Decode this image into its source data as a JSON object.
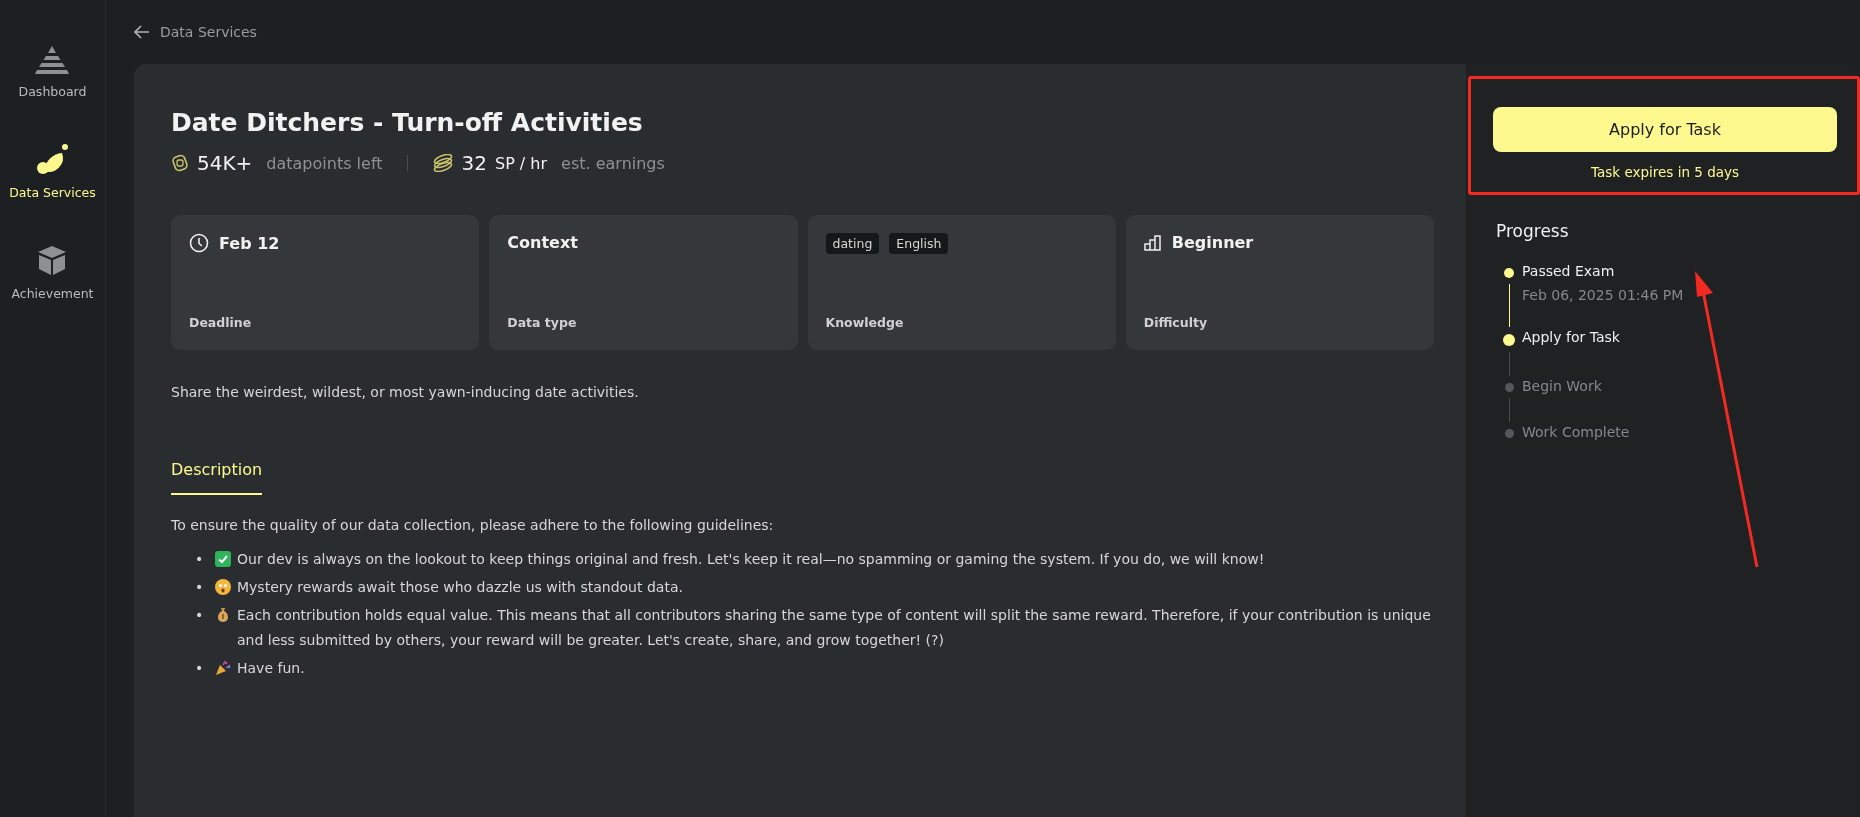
{
  "sidebar": {
    "items": [
      {
        "label": "Dashboard",
        "selected": false
      },
      {
        "label": "Data Services",
        "selected": true
      },
      {
        "label": "Achievement",
        "selected": false
      }
    ]
  },
  "breadcrumb": {
    "label": "Data Services"
  },
  "task": {
    "title": "Date Ditchers - Turn-off Activities",
    "stats": {
      "datapoints": "54K+",
      "datapoints_label": "datapoints left",
      "earnings": "32",
      "earnings_unit": "SP / hr",
      "earnings_label": "est. earnings"
    },
    "info_cards": [
      {
        "kind": "deadline",
        "value": "Feb 12",
        "label": "Deadline"
      },
      {
        "kind": "text",
        "value": "Context",
        "label": "Data type"
      },
      {
        "kind": "tags",
        "tags": [
          "dating",
          "English"
        ],
        "label": "Knowledge"
      },
      {
        "kind": "difficulty",
        "value": "Beginner",
        "label": "Difficulty"
      }
    ],
    "summary": "Share the weirdest, wildest, or most yawn-inducing date activities.",
    "tabs": [
      {
        "label": "Description",
        "selected": true
      }
    ],
    "intro": "To ensure the quality of our data collection, please adhere to the following guidelines:",
    "guidelines": [
      {
        "marker": "•",
        "text": "Our dev is always on the lookout to keep things original and fresh. Let's keep it real—no spamming or gaming the system. If you do, we will know!"
      },
      {
        "marker": "•",
        "text": "Mystery rewards await those who dazzle us with standout data."
      },
      {
        "marker": "•",
        "text": "Each contribution holds equal value. This means that all contributors sharing the same type of content will split the same reward. Therefore, if your contribution is unique and less submitted by others, your reward will be greater. Let's create, share, and grow together! (?)"
      },
      {
        "marker": "•",
        "text": "Have fun."
      }
    ]
  },
  "apply": {
    "button": "Apply for Task",
    "expiry": "Task expires in 5 days"
  },
  "progress": {
    "title": "Progress",
    "steps": [
      {
        "label": "Passed Exam",
        "date": "Feb 06, 2025 01:46 PM",
        "completed": true,
        "selected": false
      },
      {
        "label": "Apply for Task",
        "completed": false,
        "selected": true
      },
      {
        "label": "Begin Work",
        "completed": false,
        "selected": false
      },
      {
        "label": "Work Complete",
        "completed": false,
        "selected": false
      }
    ]
  }
}
